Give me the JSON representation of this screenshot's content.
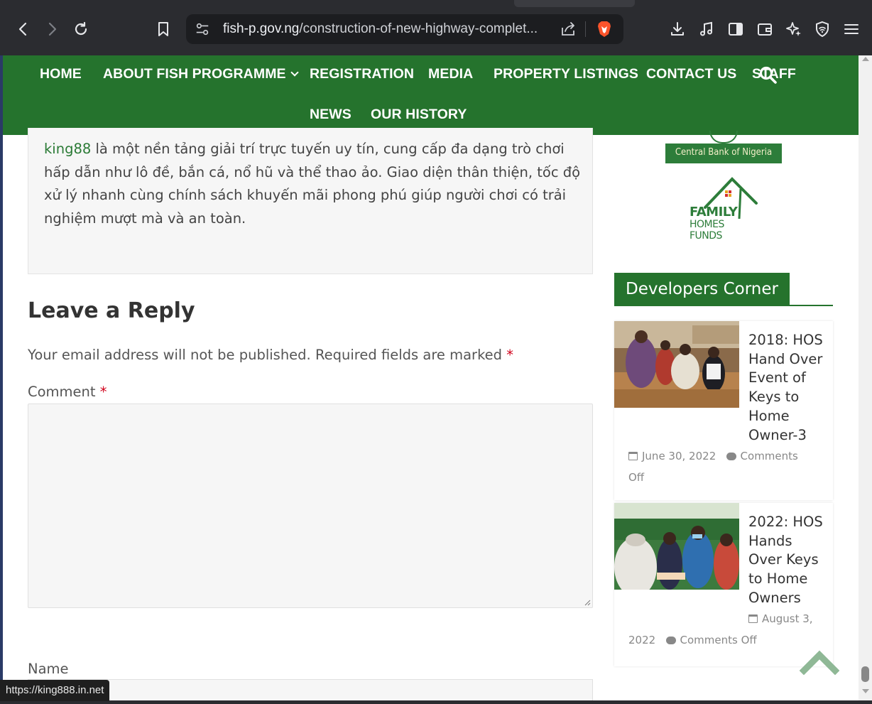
{
  "browser": {
    "url_host": "fish-p.gov.ng",
    "url_path": "/construction-of-new-highway-complet..."
  },
  "nav": {
    "items": [
      "HOME",
      "ABOUT FISH PROGRAMME",
      "REGISTRATION",
      "MEDIA",
      "PROPERTY LISTINGS",
      "CONTACT US",
      "STAFF",
      "NEWS",
      "OUR HISTORY"
    ]
  },
  "promo": {
    "link_text": "king88",
    "body": " là một nền tảng giải trí trực tuyến uy tín, cung cấp đa dạng trò chơi hấp dẫn như lô đề, bắn cá, nổ hũ và thể thao ảo. Giao diện thân thiện, tốc độ xử lý nhanh cùng chính sách khuyến mãi phong phú giúp người chơi có trải nghiệm mượt mà và an toàn."
  },
  "reply": {
    "title": "Leave a Reply",
    "notes": "Your email address will not be published. Required fields are marked",
    "required_mark": "*",
    "comment_label": "Comment",
    "name_label": "Name"
  },
  "sidebar": {
    "cbn_logo_text": "Central Bank of Nigeria",
    "fhf_logo_line1": "FAMILY",
    "fhf_logo_line2": "HOMES FUNDS",
    "section_title": "Developers Corner",
    "posts": [
      {
        "title": "2018: HOS Hand Over Event of Keys to Home Owner-3",
        "date": "June 30, 2022",
        "comments": "Comments",
        "comments_2": "Off"
      },
      {
        "title": "2022: HOS Hands Over Keys to Home Owners",
        "date": "August 3,",
        "date_2": "2022",
        "comments": "Comments Off"
      }
    ]
  },
  "status_bar": {
    "url": "https://king888.in.net"
  },
  "colors": {
    "brand_green": "#25732d",
    "required_red": "#d0021b"
  }
}
